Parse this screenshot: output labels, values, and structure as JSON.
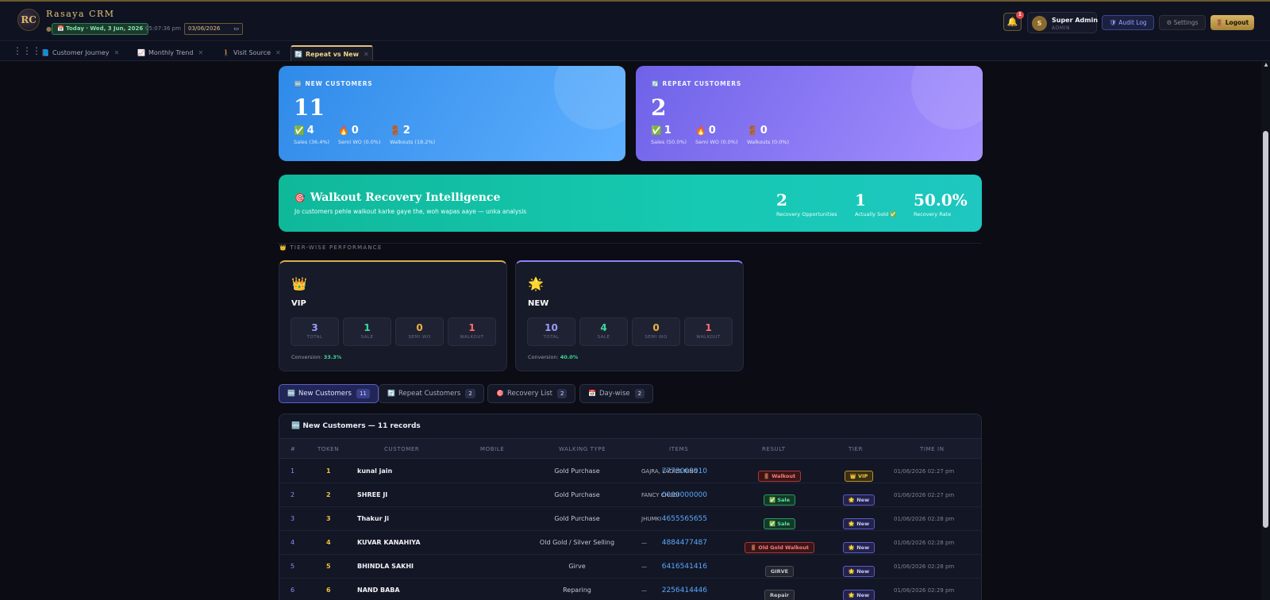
{
  "header": {
    "logo_text": "RC",
    "brand": "Rasaya CRM",
    "today_label": "📅 Today · Wed, 3 Jun, 2026",
    "time": "05:07:36 pm",
    "date_value": "03/06/2026",
    "bell_count": "1",
    "user_initial": "S",
    "user_name": "Super Admin",
    "user_role": "ADMIN",
    "audit_label": "🛡 Audit Log",
    "settings_label": "⚙ Settings",
    "logout_label": "🚪 Logout"
  },
  "tabs": [
    {
      "icon": "📘",
      "label": "Customer Journey"
    },
    {
      "icon": "📈",
      "label": "Monthly Trend"
    },
    {
      "icon": "🚶",
      "label": "Visit Source"
    },
    {
      "icon": "🔄",
      "label": "Repeat vs New"
    }
  ],
  "new_customers": {
    "heading": "NEW CUSTOMERS",
    "total": "11",
    "sales": "4",
    "sales_label": "Sales (36.4%)",
    "semi": "0",
    "semi_label": "Semi WO (0.0%)",
    "walkouts": "2",
    "walkouts_label": "Walkouts (18.2%)"
  },
  "repeat_customers": {
    "heading": "REPEAT CUSTOMERS",
    "total": "2",
    "sales": "1",
    "sales_label": "Sales (50.0%)",
    "semi": "0",
    "semi_label": "Semi WO (0.0%)",
    "walkouts": "0",
    "walkouts_label": "Walkouts (0.0%)"
  },
  "walkout_recovery": {
    "title": "Walkout Recovery Intelligence",
    "subtitle": "Jo customers pehle walkout karke gaye the, woh wapas aaye — unka analysis",
    "opportunities": "2",
    "opportunities_label": "Recovery Opportunities",
    "sold": "1",
    "sold_label": "Actually Sold ✅",
    "rate": "50.0%",
    "rate_label": "Recovery Rate"
  },
  "tier_section_label": "👑 TIER-WISE PERFORMANCE",
  "tiers": [
    {
      "icon": "👑",
      "name": "VIP",
      "total": "3",
      "sale": "1",
      "semi": "0",
      "walkout": "1",
      "conversion_label": "Conversion:",
      "conversion": "33.3%"
    },
    {
      "icon": "🌟",
      "name": "NEW",
      "total": "10",
      "sale": "4",
      "semi": "0",
      "walkout": "1",
      "conversion_label": "Conversion:",
      "conversion": "40.0%"
    }
  ],
  "tier_box_labels": {
    "total": "TOTAL",
    "sale": "SALE",
    "semi": "SEMI WO",
    "walkout": "WALKOUT"
  },
  "list_tabs": [
    {
      "icon": "🆕",
      "label": "New Customers",
      "count": "11"
    },
    {
      "icon": "🔄",
      "label": "Repeat Customers",
      "count": "2"
    },
    {
      "icon": "🎯",
      "label": "Recovery List",
      "count": "2"
    },
    {
      "icon": "📅",
      "label": "Day-wise",
      "count": "2"
    }
  ],
  "table": {
    "title": "🆕 New Customers — 11 records",
    "headers": [
      "#",
      "TOKEN",
      "CUSTOMER",
      "MOBILE",
      "WALKING TYPE",
      "ITEMS",
      "RESULT",
      "TIER",
      "TIME IN"
    ],
    "rows": [
      {
        "num": "1",
        "token": "1",
        "customer": "kunal jain",
        "mobile": "7773008910",
        "walking": "Gold Purchase",
        "items": "GAJRA, LADIES RING",
        "result": "🚪 Walkout",
        "result_type": "walkout",
        "tier": "👑 VIP",
        "tier_type": "vip",
        "time": "01/06/2026 02:27 pm"
      },
      {
        "num": "2",
        "token": "2",
        "customer": "SHREE JI",
        "mobile": "0000000000",
        "walking": "Gold Purchase",
        "items": "FANCY CHUDI",
        "result": "✅ Sale",
        "result_type": "sale",
        "tier": "🌟 New",
        "tier_type": "new",
        "time": "01/06/2026 02:27 pm"
      },
      {
        "num": "3",
        "token": "3",
        "customer": "Thakur Ji",
        "mobile": "4655565655",
        "walking": "Gold Purchase",
        "items": "JHUMKI",
        "result": "✅ Sale",
        "result_type": "sale",
        "tier": "🌟 New",
        "tier_type": "new",
        "time": "01/06/2026 02:28 pm"
      },
      {
        "num": "4",
        "token": "4",
        "customer": "KUVAR KANAHIYA",
        "mobile": "4884477487",
        "walking": "Old Gold / Silver Selling",
        "items": "—",
        "result": "🚪 Old Gold Walkout",
        "result_type": "walkout",
        "tier": "🌟 New",
        "tier_type": "new",
        "time": "01/06/2026 02:28 pm"
      },
      {
        "num": "5",
        "token": "5",
        "customer": "BHINDLA SAKHI",
        "mobile": "6416541416",
        "walking": "Girve",
        "items": "—",
        "result": "GIRVE",
        "result_type": "gray",
        "tier": "🌟 New",
        "tier_type": "new",
        "time": "01/06/2026 02:28 pm"
      },
      {
        "num": "6",
        "token": "6",
        "customer": "NAND BABA",
        "mobile": "2256414446",
        "walking": "Reparing",
        "items": "—",
        "result": "Repair",
        "result_type": "gray",
        "tier": "🌟 New",
        "tier_type": "new",
        "time": "01/06/2026 02:29 pm"
      }
    ]
  }
}
